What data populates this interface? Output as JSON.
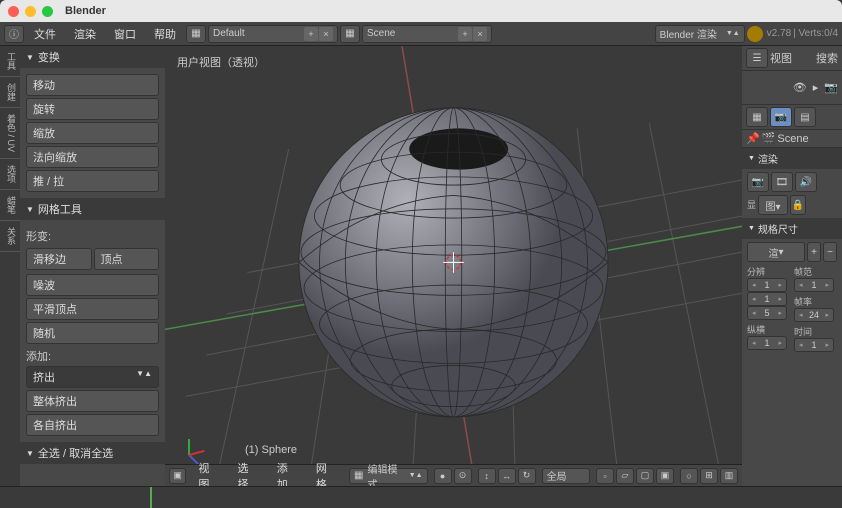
{
  "window": {
    "title": "Blender"
  },
  "menubar": {
    "file": "文件",
    "render": "渲染",
    "window": "窗口",
    "help": "帮助",
    "layout": "Default",
    "scene": "Scene",
    "engine": "Blender 渲染",
    "version": "v2.78",
    "stats": "Verts:0/4"
  },
  "left_tabs": [
    "工具",
    "创建",
    "着色 / UV",
    "选项",
    "蜡笔",
    "关系"
  ],
  "tools": {
    "transform": {
      "title": "变换",
      "translate": "移动",
      "rotate": "旋转",
      "scale": "缩放",
      "normal_scale": "法向缩放",
      "push_pull": "推 / 拉"
    },
    "mesh": {
      "title": "网格工具",
      "deform_label": "形变:",
      "edge_slide": "滑移边",
      "vertex": "顶点",
      "noise": "噪波",
      "smooth_vertex": "平滑顶点",
      "random": "随机",
      "add_label": "添加:",
      "extrude": "挤出",
      "extrude_whole": "整体挤出",
      "extrude_individual": "各自挤出"
    },
    "select_all": {
      "title": "全选 / 取消全选"
    }
  },
  "viewport": {
    "label": "用户视图（透视）",
    "object": "(1) Sphere"
  },
  "vp_header": {
    "view": "视图",
    "select": "选择",
    "add": "添加",
    "mesh": "网格",
    "mode": "编辑模式",
    "orientation": "全局"
  },
  "outliner": {
    "view": "视图",
    "search": "搜索"
  },
  "properties": {
    "scene": "Scene",
    "render": {
      "title": "渲染",
      "show": "显"
    },
    "dimensions": {
      "title": "规格尺寸",
      "preset": "渲",
      "res_label": "分辨",
      "frame_label": "帧范",
      "res_x": 1,
      "res_y": 1,
      "res_pct": 5,
      "frame_start": 1,
      "aspect_label": "纵横",
      "fps_label": "帧率",
      "aspect": 1,
      "fps": 24,
      "time_label": "时间",
      "frame_end": 1
    }
  },
  "chart_data": {
    "type": "3d-mesh",
    "object": "UV Sphere",
    "segments": 32,
    "rings": 16,
    "note": "Top polar cap deleted (hole at top)",
    "mode": "Edit Mode",
    "shading": "Solid wireframe"
  }
}
